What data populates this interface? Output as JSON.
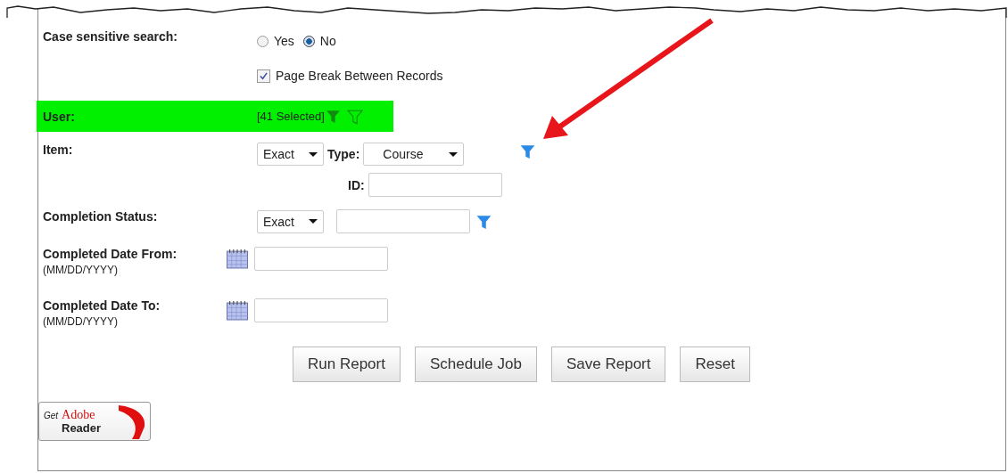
{
  "case_sensitive": {
    "label": "Case sensitive search:",
    "options": [
      {
        "label": "Yes",
        "selected": false
      },
      {
        "label": "No",
        "selected": true
      }
    ]
  },
  "page_break": {
    "label": "Page Break Between Records",
    "checked": true
  },
  "user": {
    "label": "User:",
    "selection": "[41 Selected]",
    "highlighted": true
  },
  "item": {
    "label": "Item:",
    "match": "Exact",
    "type_label": "Type:",
    "type": "Course",
    "id_label": "ID:"
  },
  "completion_status": {
    "label": "Completion Status:",
    "match": "Exact"
  },
  "dates": [
    {
      "label": "Completed Date From:",
      "format": "(MM/DD/YYYY)"
    },
    {
      "label": "Completed Date To:",
      "format": "(MM/DD/YYYY)"
    }
  ],
  "buttons": [
    "Run Report",
    "Schedule Job",
    "Save Report",
    "Reset"
  ],
  "adobe_badge": {
    "get": "Get",
    "brand": "Adobe",
    "product": "Reader"
  }
}
